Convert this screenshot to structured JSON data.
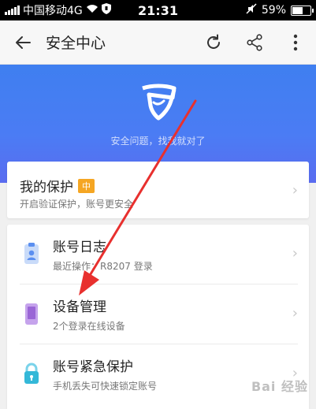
{
  "status_bar": {
    "carrier": "中国移动4G",
    "time": "21:31",
    "battery": "59%"
  },
  "app_bar": {
    "title": "安全中心",
    "icons": [
      "back-arrow-icon",
      "refresh-icon",
      "share-icon",
      "more-icon"
    ]
  },
  "hero": {
    "tagline": "安全问题，找我就对了"
  },
  "protection": {
    "title": "我的保护",
    "level": "中",
    "subtitle": "开启验证保护，账号更安全"
  },
  "list": [
    {
      "title": "账号日志",
      "subtitle": "最近操作：R8207 登录",
      "icon": "clipboard-icon"
    },
    {
      "title": "设备管理",
      "subtitle": "2个登录在线设备",
      "icon": "phone-icon"
    },
    {
      "title": "账号紧急保护",
      "subtitle": "手机丢失可快速锁定账号",
      "icon": "lock-icon"
    }
  ],
  "watermark": "Bai 经验",
  "colors": {
    "hero": "#4b7cf4",
    "badge": "#f5a623",
    "annotation_arrow": "#e8302e"
  }
}
